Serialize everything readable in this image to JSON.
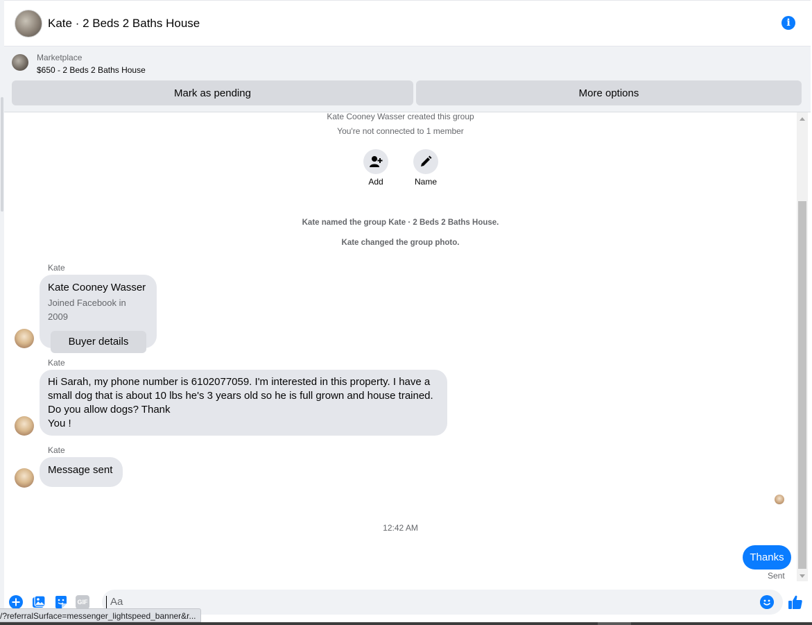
{
  "header": {
    "title": "Kate · 2 Beds 2 Baths House"
  },
  "marketplace": {
    "label": "Marketplace",
    "listing": "$650 - 2 Beds 2 Baths House",
    "pending_button": "Mark as pending",
    "more_button": "More options"
  },
  "group_info": {
    "created": "Kate Cooney Wasser created this group",
    "connection": "You're not connected to 1 member",
    "add_label": "Add",
    "name_label": "Name"
  },
  "system_messages": [
    "Kate named the group Kate · 2 Beds 2 Baths House.",
    "Kate changed the group photo."
  ],
  "messages": [
    {
      "sender": "Kate",
      "card_name": "Kate Cooney Wasser",
      "card_sub": "Joined Facebook in 2009",
      "card_button": "Buyer details"
    },
    {
      "sender": "Kate",
      "lines": [
        "Hi Sarah, my phone number is 6102077059. I'm interested in this property. I have a",
        "small dog that is about 10 lbs he's 3 years old so he is full grown and house trained.",
        "Do you allow dogs? Thank",
        "You !"
      ]
    },
    {
      "sender": "Kate",
      "text": "Message sent"
    }
  ],
  "timestamp": "12:42 AM",
  "outgoing": {
    "text": "Thanks",
    "status": "Sent"
  },
  "composer": {
    "placeholder": "Aa",
    "gif_label": "GIF"
  },
  "status_bar": {
    "url": "/?referralSurface=messenger_lightspeed_banner&r..."
  },
  "colors": {
    "accent": "#0a7cff",
    "bubble_in": "#e4e6eb",
    "banner_bg": "#f0f2f5"
  }
}
